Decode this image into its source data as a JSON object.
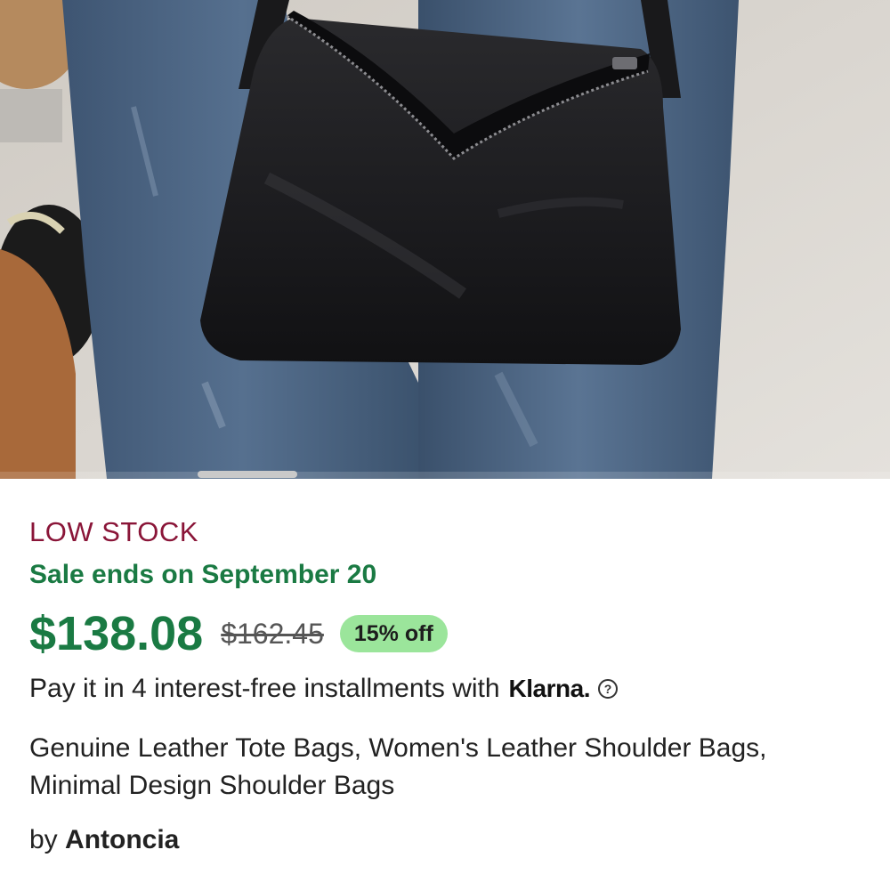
{
  "product_image": {
    "description_icon": "product-photo",
    "carousel_position": 1
  },
  "listing": {
    "stock_label": "LOW STOCK",
    "sale_ends": "Sale ends on September 20",
    "price_current": "$138.08",
    "price_original": "$162.45",
    "discount_badge": "15% off",
    "installments_text": "Pay it in 4 interest-free installments with",
    "klarna_label": "Klarna.",
    "help_icon": "?",
    "title": "Genuine Leather Tote Bags, Women's Leather Shoulder Bags, Minimal Design Shoulder Bags",
    "seller_prefix": "by",
    "seller_name": "Antoncia"
  },
  "colors": {
    "stock": "#8a1538",
    "sale": "#1a7a43",
    "badge_bg": "#9be59b"
  }
}
